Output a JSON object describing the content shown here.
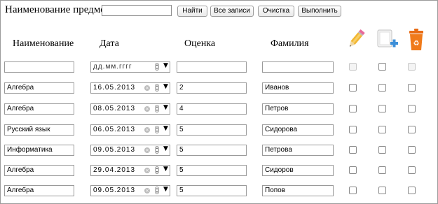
{
  "search": {
    "label": "Наименование предмета",
    "value": ""
  },
  "buttons": {
    "find": "Найти",
    "all_records": "Все записи",
    "clear": "Очистка",
    "execute": "Выполнить"
  },
  "columns": {
    "name": "Наименование",
    "date": "Дата",
    "grade": "Оценка",
    "surname": "Фамилия"
  },
  "header_icons": [
    "pencil-edit-icon",
    "add-record-icon",
    "recycle-bin-delete-icon"
  ],
  "filter_row": {
    "name": "",
    "date_placeholder": "дд.мм.гггг",
    "grade": "",
    "surname": ""
  },
  "rows": [
    {
      "name": "Алгебра",
      "date": "16.05.2013",
      "grade": "2",
      "surname": "Иванов"
    },
    {
      "name": "Алгебра",
      "date": "08.05.2013",
      "grade": "4",
      "surname": "Петров"
    },
    {
      "name": "Русский язык",
      "date": "06.05.2013",
      "grade": "5",
      "surname": "Сидорова"
    },
    {
      "name": "Информатика",
      "date": "09.05.2013",
      "grade": "5",
      "surname": "Петрова"
    },
    {
      "name": "Алгебра",
      "date": "29.04.2013",
      "grade": "5",
      "surname": "Сидоров"
    },
    {
      "name": "Алгебра",
      "date": "09.05.2013",
      "grade": "5",
      "surname": "Попов"
    }
  ],
  "colors": {
    "pencil": "#f2b632",
    "plus": "#3d8fd8",
    "bin": "#f07a1a"
  }
}
